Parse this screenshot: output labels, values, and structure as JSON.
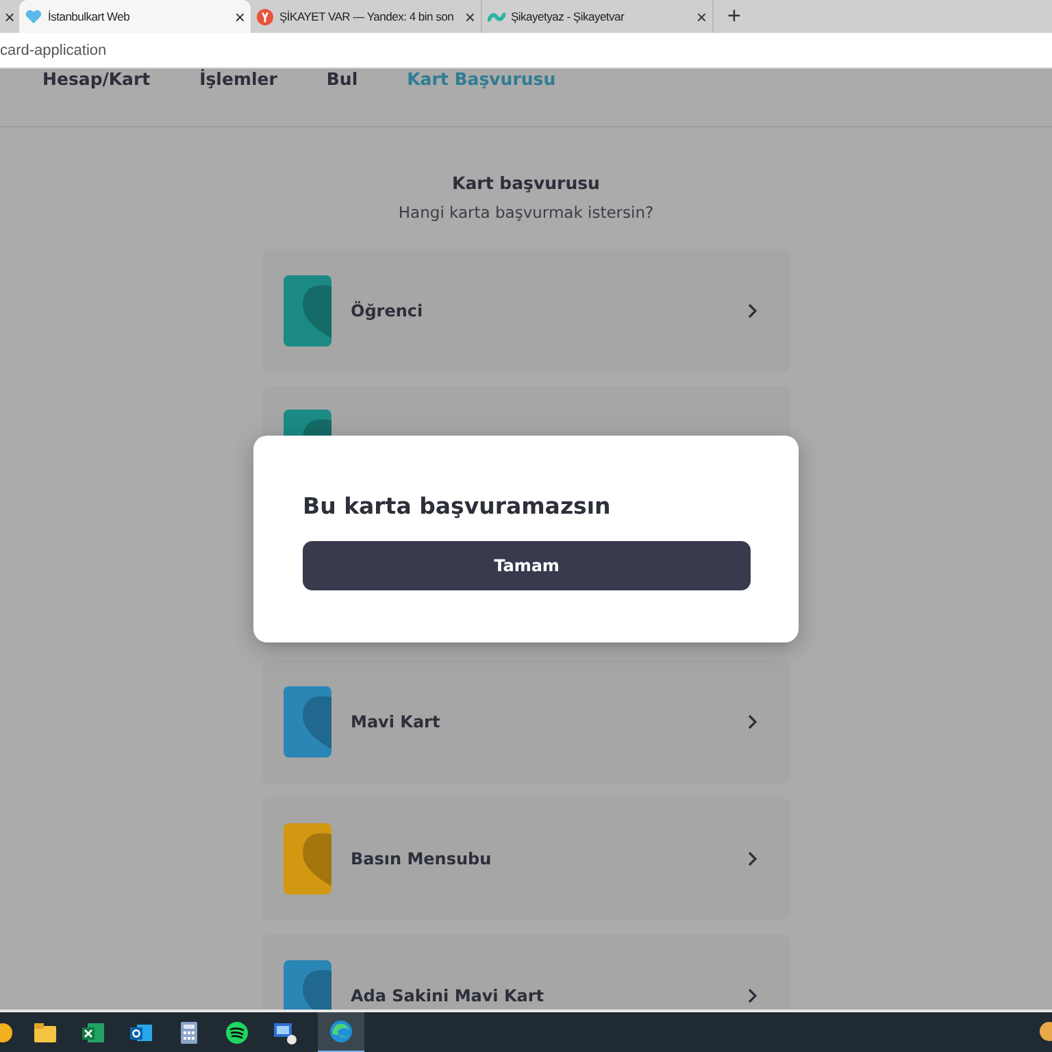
{
  "browser": {
    "tabs": [
      {
        "title": "İstanbulkart Web",
        "selected": true
      },
      {
        "title": "ŞİKAYET VAR — Yandex: 4 bin son",
        "selected": false
      },
      {
        "title": "Şikayetyaz - Şikayetvar",
        "selected": false
      }
    ],
    "new_tab": "+",
    "close": "×",
    "address": "card-application"
  },
  "nav": [
    {
      "label": "Hesap/Kart",
      "selected": false
    },
    {
      "label": "İşlemler",
      "selected": false
    },
    {
      "label": "Bul",
      "selected": false
    },
    {
      "label": "Kart Başvurusu",
      "selected": true
    }
  ],
  "heading": "Kart başvurusu",
  "subtitle": "Hangi karta başvurmak istersin?",
  "cards": [
    {
      "label": "Öğrenci",
      "color": "#1c8a84"
    },
    {
      "color": "#1c8a84"
    },
    {
      "label": "Mavi Kart",
      "color": "#2a86b5"
    },
    {
      "label": "Basın Mensubu",
      "color": "#d29812"
    },
    {
      "label": "Ada Sakini Mavi Kart",
      "color": "#2a86b5"
    }
  ],
  "modal": {
    "title": "Bu karta başvuramazsın",
    "button": "Tamam"
  },
  "taskbar": [
    {
      "kind": "partial"
    },
    {
      "kind": "folder",
      "selected": false
    },
    {
      "kind": "excel",
      "selected": false
    },
    {
      "kind": "outlook",
      "selected": false
    },
    {
      "kind": "calculator",
      "selected": false
    },
    {
      "kind": "spotify",
      "selected": false
    },
    {
      "kind": "computer",
      "selected": false
    },
    {
      "kind": "edge",
      "selected": true
    }
  ]
}
